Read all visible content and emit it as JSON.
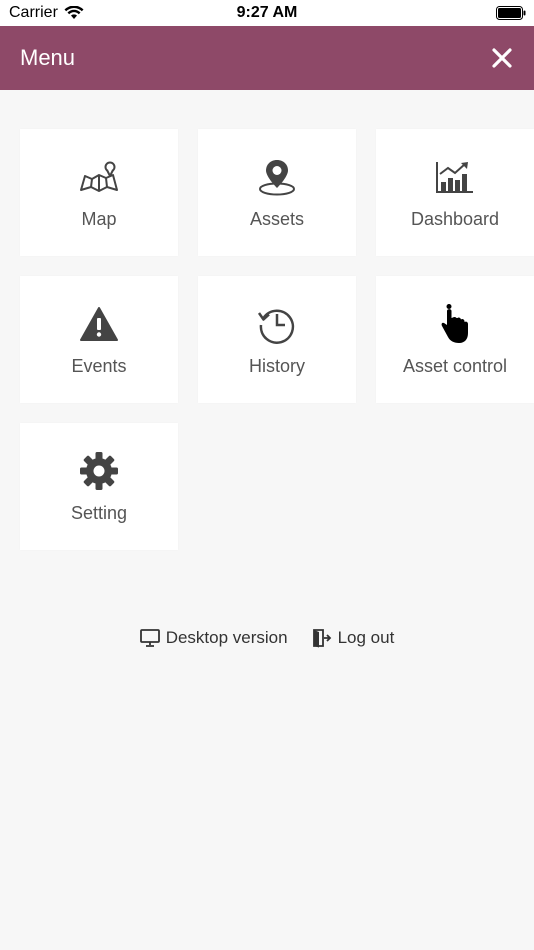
{
  "status_bar": {
    "carrier": "Carrier",
    "time": "9:27 AM"
  },
  "header": {
    "title": "Menu",
    "bg_color": "#8e4968"
  },
  "tiles": [
    {
      "label": "Map",
      "icon": "map-icon"
    },
    {
      "label": "Assets",
      "icon": "location-pin-icon"
    },
    {
      "label": "Dashboard",
      "icon": "chart-icon"
    },
    {
      "label": "Events",
      "icon": "warning-icon"
    },
    {
      "label": "History",
      "icon": "history-icon"
    },
    {
      "label": "Asset control",
      "icon": "hand-pointer-icon"
    },
    {
      "label": "Setting",
      "icon": "gear-icon"
    }
  ],
  "footer": {
    "desktop_label": "Desktop version",
    "logout_label": "Log out"
  }
}
